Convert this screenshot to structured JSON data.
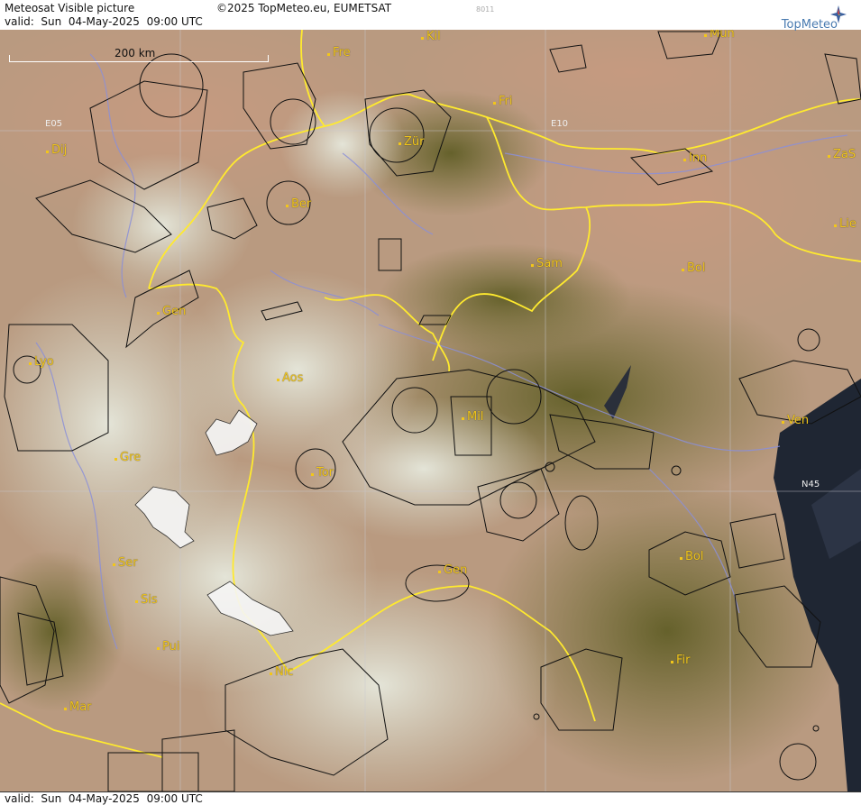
{
  "header": {
    "title": "Meteosat Visible picture",
    "copyright": "©2025 TopMeteo.eu, EUMETSAT",
    "image_code": "8011",
    "valid": "valid:  Sun  04-May-2025  09:00 UTC",
    "logo_text": "TopMeteo"
  },
  "footer": {
    "valid": "valid:  Sun  04-May-2025  09:00 UTC"
  },
  "map": {
    "scale_label": "200 km",
    "grid_labels": {
      "e05": "E05",
      "e10": "E10",
      "n45": "N45"
    },
    "cities": {
      "kil": "Kil",
      "mun": "Mun",
      "fre": "Fre",
      "fri": "Fri",
      "zur": "Zür",
      "dij": "Dij",
      "inn": "Inn",
      "zas": "ZaS",
      "ber": "Ber",
      "lie": "Lie",
      "sam": "Sam",
      "bol_n": "Bol",
      "gen_ch": "Gen",
      "lyo": "Lyo",
      "aos": "Aos",
      "mil": "Mil",
      "ven": "Ven",
      "gre": "Gre",
      "tor": "Tor",
      "ser": "Ser",
      "gen_it": "Gen",
      "bol_s": "Bol",
      "sis": "Sis",
      "pui": "Pui",
      "nic": "Nic",
      "fir": "Fir",
      "mar": "Mar"
    },
    "colors": {
      "cloud": "#d9dccf",
      "land_green": "#6f6a2f",
      "land_tan": "#c8a489",
      "sea": "#1f2633",
      "border": "#ffea2e",
      "river": "#8b8fd8",
      "airspace": "#111111",
      "city": "#f2c61a"
    }
  }
}
